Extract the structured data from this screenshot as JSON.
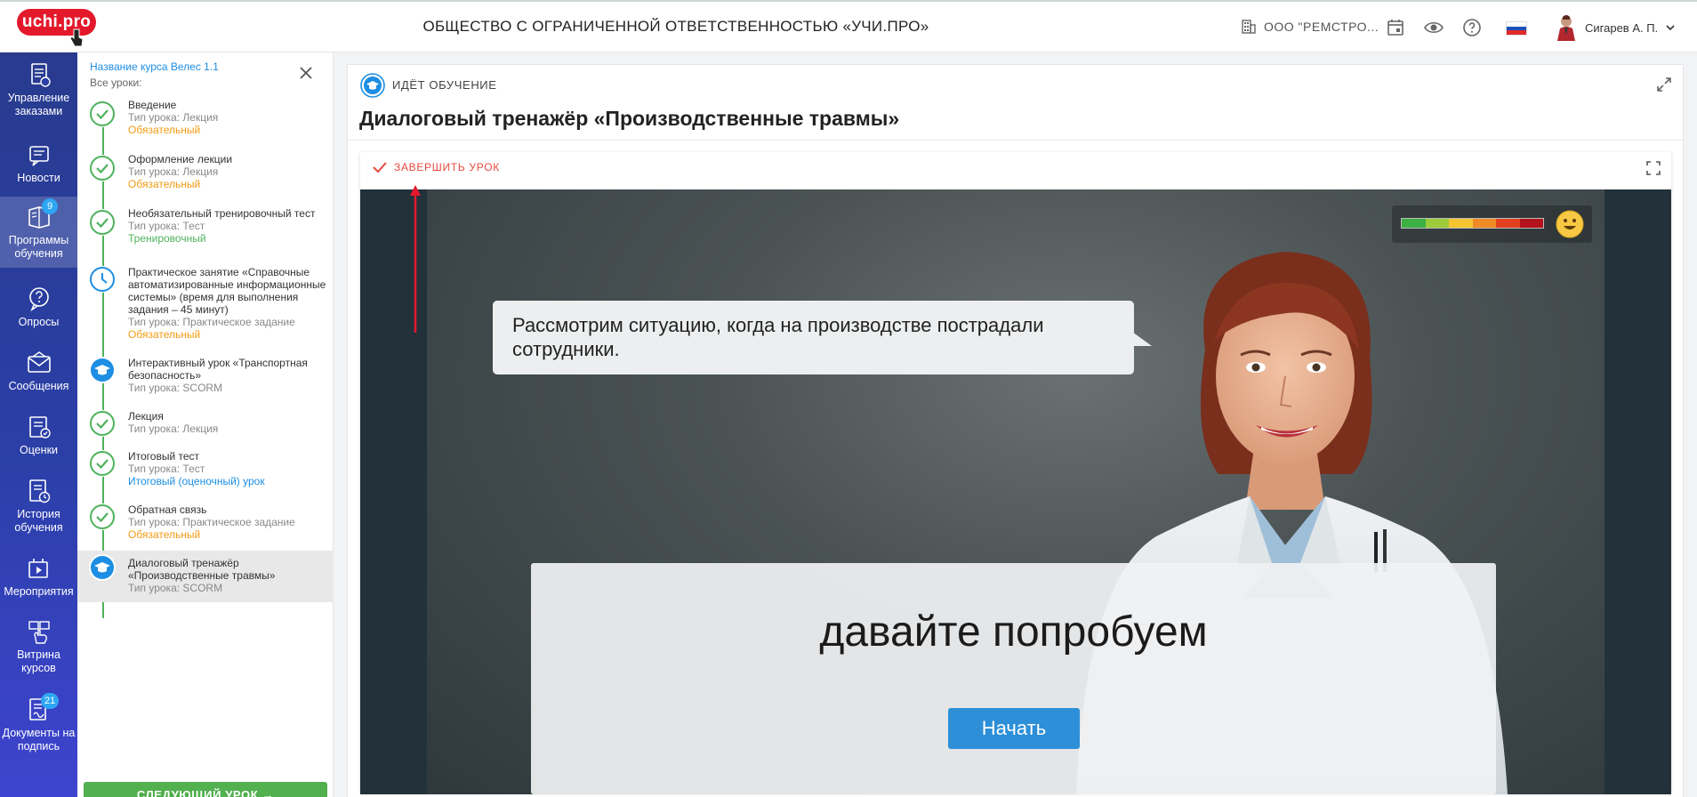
{
  "header": {
    "logo_text": "uchi.pro",
    "org_title": "ОБЩЕСТВО С ОГРАНИЧЕННОЙ ОТВЕТСТВЕННОСТЬЮ «УЧИ.ПРО»",
    "company": "ООО \"РЕМСТРО...",
    "user_name": "Сигарев А. П."
  },
  "nav": {
    "items": [
      {
        "label": "Управление заказами",
        "icon": "orders-icon"
      },
      {
        "label": "Новости",
        "icon": "news-icon"
      },
      {
        "label": "Программы обучения",
        "icon": "programs-icon",
        "badge": "9"
      },
      {
        "label": "Опросы",
        "icon": "surveys-icon"
      },
      {
        "label": "Сообщения",
        "icon": "messages-icon"
      },
      {
        "label": "Оценки",
        "icon": "grades-icon"
      },
      {
        "label": "История обучения",
        "icon": "history-icon"
      },
      {
        "label": "Мероприятия",
        "icon": "events-icon"
      },
      {
        "label": "Витрина курсов",
        "icon": "showcase-icon"
      },
      {
        "label": "Документы на подпись",
        "icon": "documents-icon",
        "badge": "21"
      }
    ]
  },
  "lessons_panel": {
    "course_name": "Название курса Велес 1.1",
    "all_lessons": "Все уроки:",
    "next_button": "СЛЕДУЮЩИЙ УРОК →",
    "lessons": [
      {
        "title": "Введение",
        "type": "Тип урока: Лекция",
        "tag": "Обязательный",
        "status": "done"
      },
      {
        "title": "Оформление лекции",
        "type": "Тип урока: Лекция",
        "tag": "Обязательный",
        "status": "done"
      },
      {
        "title": "Необязательный тренировочный тест",
        "type": "Тип урока: Тест",
        "tag": "Тренировочный",
        "status": "done"
      },
      {
        "title": "Практическое занятие «Справочные автоматизированные информационные системы» (время для выполнения задания – 45 минут)",
        "type": "Тип урока: Практическое задание",
        "tag": "Обязательный",
        "status": "pending"
      },
      {
        "title": "Интерактивный урок «Транспортная безопасность»",
        "type": "Тип урока: SCORM",
        "tag": "",
        "status": "active"
      },
      {
        "title": "Лекция",
        "type": "Тип урока: Лекция",
        "tag": "",
        "status": "done"
      },
      {
        "title": "Итоговый тест",
        "type": "Тип урока: Тест",
        "tag": "Итоговый (оценочный) урок",
        "status": "done"
      },
      {
        "title": "Обратная связь",
        "type": "Тип урока: Практическое задание",
        "tag": "Обязательный",
        "status": "done"
      },
      {
        "title": "Диалоговый тренажёр «Производственные травмы»",
        "type": "Тип урока: SCORM",
        "tag": "",
        "status": "active"
      }
    ]
  },
  "main": {
    "status": "ИДЁТ ОБУЧЕНИЕ",
    "lesson_title": "Диалоговый тренажёр «Производственные травмы»",
    "finish_lesson": "ЗАВЕРШИТЬ УРОК",
    "speech_bubble": "Рассмотрим ситуацию, когда на производстве пострадали сотрудники.",
    "dialog_text": "давайте попробуем",
    "start_button": "Начать"
  },
  "colors": {
    "brand_red": "#e3192b",
    "nav_blue": "#2b3fa8",
    "accent_blue": "#1d8ee3",
    "done_green": "#4fb25c",
    "required_orange": "#f39b12",
    "finish_red": "#e84a3f"
  }
}
